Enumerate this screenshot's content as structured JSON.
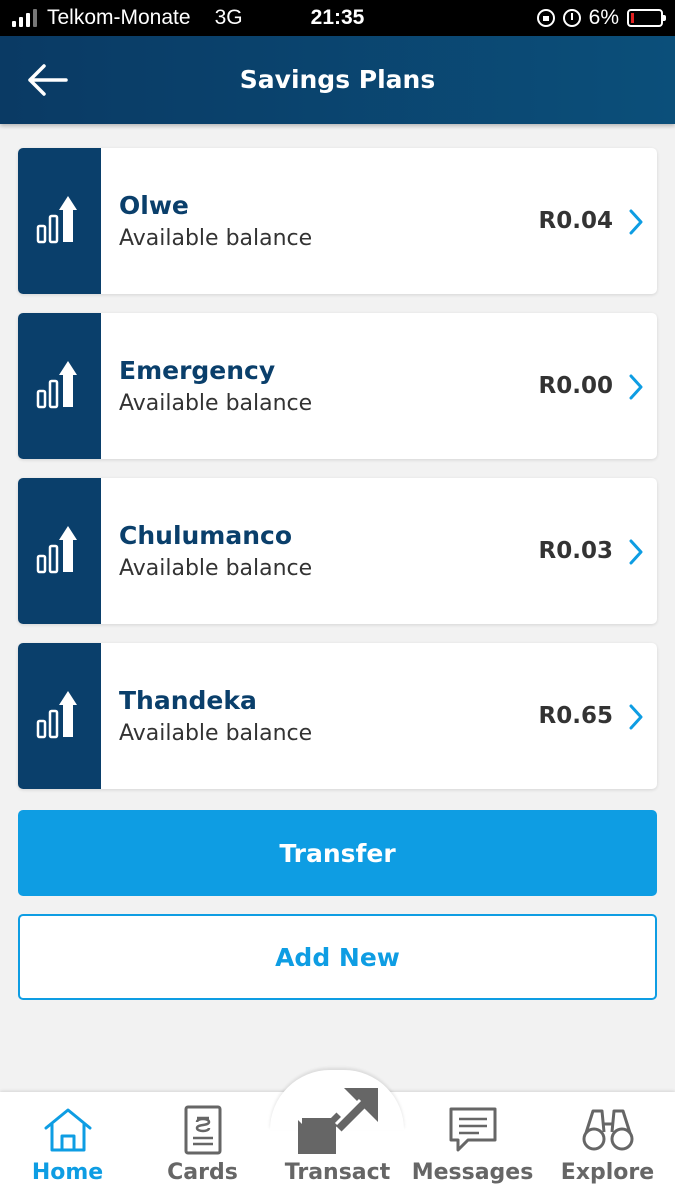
{
  "status_bar": {
    "carrier": "Telkom-Monate",
    "network": "3G",
    "time": "21:35",
    "battery": "6%"
  },
  "header": {
    "title": "Savings Plans",
    "back_icon": "arrow-left-icon"
  },
  "plans": [
    {
      "name": "Olwe",
      "subtitle": "Available balance",
      "balance": "R0.04"
    },
    {
      "name": "Emergency",
      "subtitle": "Available balance",
      "balance": "R0.00"
    },
    {
      "name": "Chulumanco",
      "subtitle": "Available balance",
      "balance": "R0.03"
    },
    {
      "name": "Thandeka",
      "subtitle": "Available balance",
      "balance": "R0.65"
    }
  ],
  "actions": {
    "transfer_label": "Transfer",
    "add_new_label": "Add New"
  },
  "tabs": [
    {
      "label": "Home",
      "icon": "home-icon",
      "active": true
    },
    {
      "label": "Cards",
      "icon": "card-icon",
      "active": false
    },
    {
      "label": "Transact",
      "icon": "transact-arrows-icon",
      "active": false
    },
    {
      "label": "Messages",
      "icon": "message-icon",
      "active": false
    },
    {
      "label": "Explore",
      "icon": "binoculars-icon",
      "active": false
    }
  ],
  "colors": {
    "header": "#0a3f6b",
    "accent": "#0e9de3",
    "background": "#f2f2f2"
  }
}
